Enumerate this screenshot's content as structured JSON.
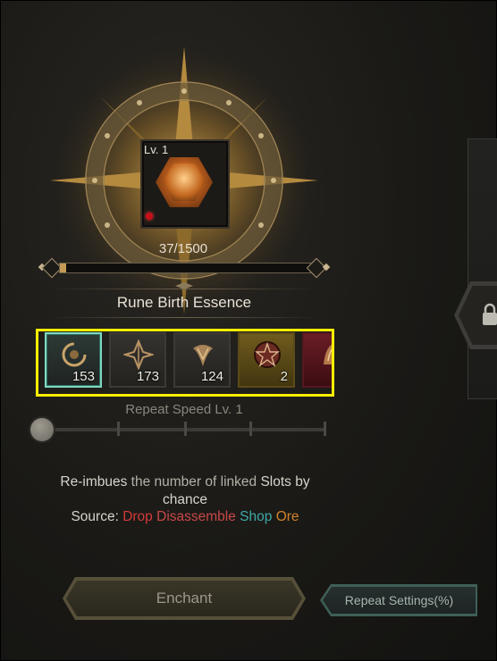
{
  "rune": {
    "level": "Lv. 1",
    "progress_text": "37/1500",
    "progress_fraction": 0.0247,
    "name": "Rune Birth Essence"
  },
  "materials": [
    {
      "name": "spiral-rune-material-icon",
      "count": "153",
      "style": "selected"
    },
    {
      "name": "star-rune-material-icon",
      "count": "173",
      "style": "normal"
    },
    {
      "name": "claw-rune-material-icon",
      "count": "124",
      "style": "normal"
    },
    {
      "name": "pentagram-orb-material-icon",
      "count": "2",
      "style": "gold"
    },
    {
      "name": "red-rune-material-icon",
      "count": "",
      "style": "red"
    }
  ],
  "repeat_speed": {
    "label": "Repeat Speed Lv. 1",
    "level": 1,
    "max_level": 5
  },
  "description": {
    "w1": "Re-imbues",
    "w2": "the number of linked",
    "w3": "Slots",
    "w4": "by",
    "w5": "chance"
  },
  "source": {
    "label": "Source:",
    "drop": "Drop",
    "disassemble": "Disassemble",
    "shop": "Shop",
    "ore": "Ore"
  },
  "buttons": {
    "enchant": "Enchant",
    "repeat_settings": "Repeat Settings(%)"
  },
  "colors": {
    "highlight": "#ffee00",
    "drop": "#d13a3a",
    "disassemble": "#c84848",
    "shop": "#3fa9a8",
    "ore": "#d0822f"
  }
}
